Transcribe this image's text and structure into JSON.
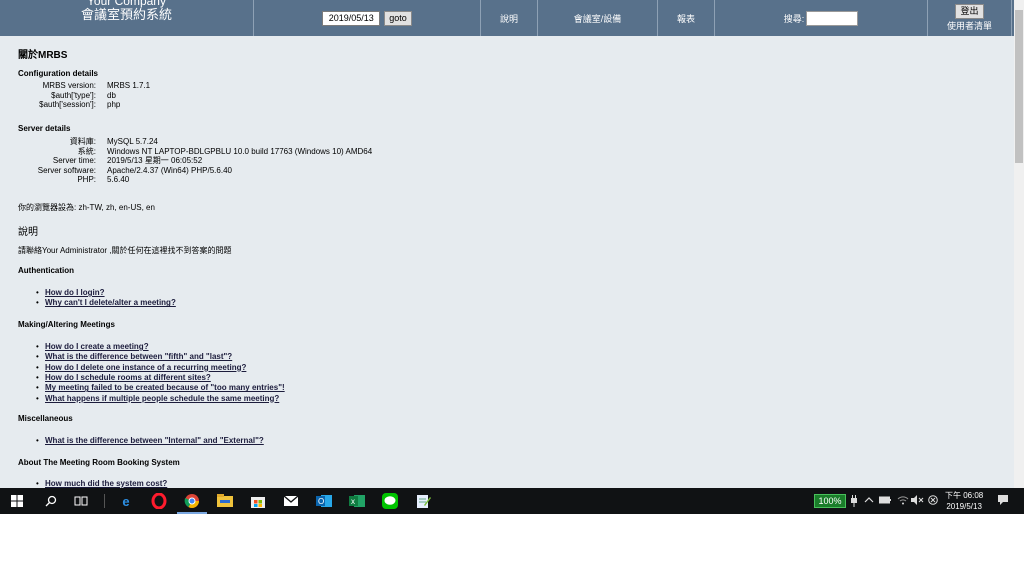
{
  "header": {
    "company": "Your Company",
    "system_title": "會議室預約系統",
    "date_value": "2019/05/13",
    "goto_label": "goto",
    "help_label": "說明",
    "rooms_label": "會議室/設備",
    "report_label": "報表",
    "search_label": "搜尋:",
    "logout_label": "登出",
    "userlist_label": "使用者清單"
  },
  "page": {
    "title": "關於MRBS",
    "config_heading": "Configuration details",
    "config": [
      {
        "k": "MRBS version:",
        "v": "MRBS 1.7.1"
      },
      {
        "k": "$auth['type']:",
        "v": "db"
      },
      {
        "k": "$auth['session']:",
        "v": "php"
      }
    ],
    "server_heading": "Server details",
    "server": [
      {
        "k": "資料庫:",
        "v": "MySQL 5.7.24"
      },
      {
        "k": "系統:",
        "v": "Windows NT LAPTOP-BDLGPBLU 10.0 build 17763 (Windows 10) AMD64"
      },
      {
        "k": "Server time:",
        "v": "2019/5/13 星期一 06:05:52"
      },
      {
        "k": "Server software:",
        "v": "Apache/2.4.37 (Win64) PHP/5.6.40"
      },
      {
        "k": "PHP:",
        "v": "5.6.40"
      }
    ],
    "browser_lang": "你的瀏覽器設為: zh-TW, zh, en-US, en",
    "help_heading": "說明",
    "contact": "請聯絡Your Administrator ,關於任何在這裡找不到答案的問題",
    "auth_heading": "Authentication",
    "auth_faq": [
      "How do I login?",
      "Why can't I delete/alter a meeting?"
    ],
    "making_heading": "Making/Altering Meetings",
    "making_faq": [
      "How do I create a meeting?",
      "What is the difference between \"fifth\" and \"last\"?",
      "How do I delete one instance of a recurring meeting?",
      "How do I schedule rooms at different sites?",
      "My meeting failed to be created because of \"too many entries\"!",
      "What happens if multiple people schedule the same meeting?"
    ],
    "misc_heading": "Miscellaneous",
    "misc_faq": [
      "What is the difference between \"Internal\" and \"External\"?"
    ],
    "about_heading": "About The Meeting Room Booking System",
    "about_faq": [
      "How much did the system cost?"
    ]
  },
  "taskbar": {
    "battery": "100%",
    "time": "下午 06:08",
    "date": "2019/5/13"
  }
}
